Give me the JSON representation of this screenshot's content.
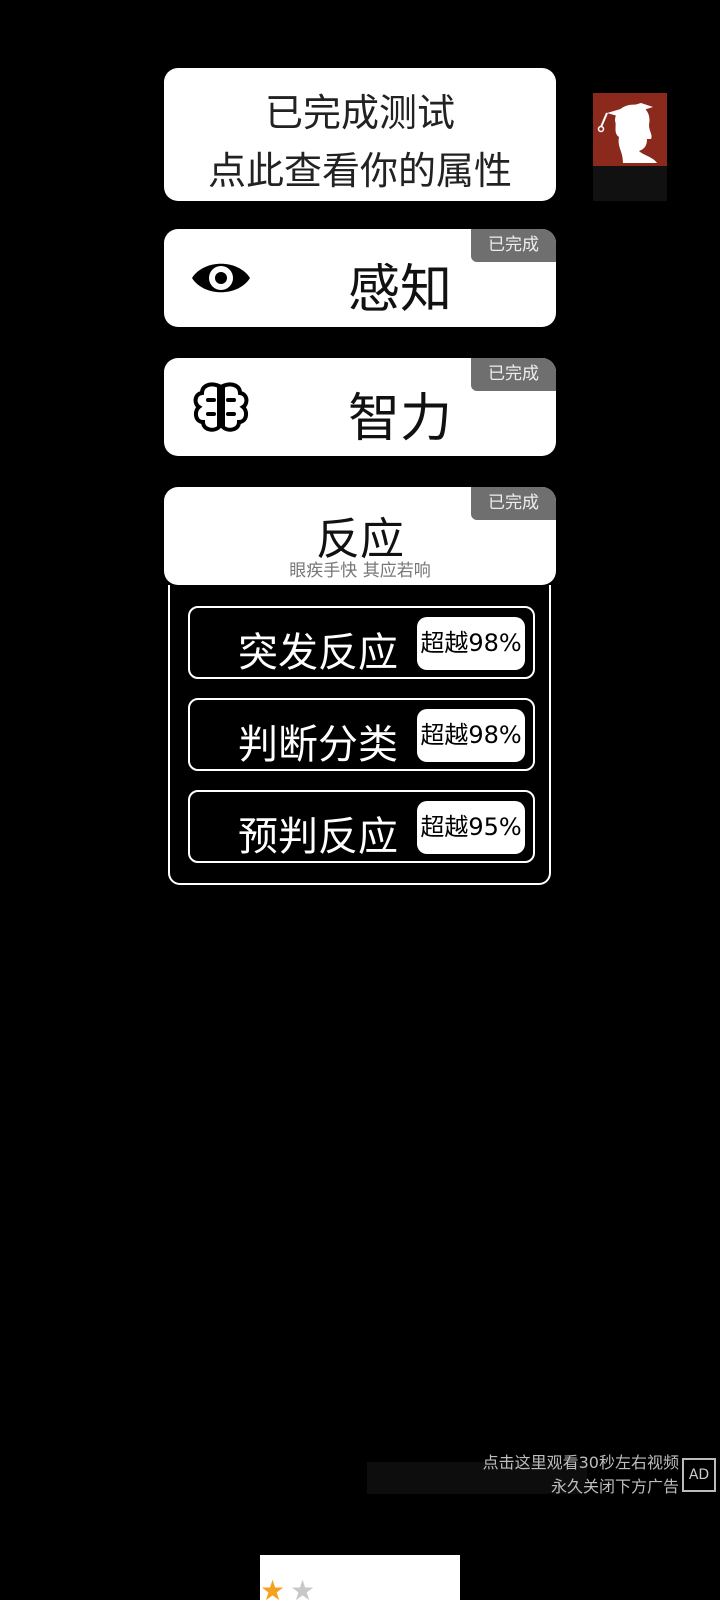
{
  "result_card": {
    "line1": "已完成测试",
    "line2": "点此查看你的属性"
  },
  "attributes": [
    {
      "title": "感知",
      "badge": "已完成",
      "icon": "eye-icon"
    },
    {
      "title": "智力",
      "badge": "已完成",
      "icon": "brain-icon"
    },
    {
      "title": "反应",
      "badge": "已完成",
      "subtitle": "眼疾手快 其应若响"
    }
  ],
  "reaction_details": [
    {
      "label": "突发反应",
      "score": "超越98%"
    },
    {
      "label": "判断分类",
      "score": "超越98%"
    },
    {
      "label": "预判反应",
      "score": "超越95%"
    }
  ],
  "ad": {
    "line1": "点击这里观看30秒左右视频",
    "line2": "永久关闭下方广告",
    "icon": "ad-off-icon",
    "icon_text": "AD"
  },
  "banner": {
    "stars_filled": 1,
    "stars_total": 2
  },
  "colors": {
    "background": "#000000",
    "badge": "#6f6f6f",
    "avatar_bg": "#8b2a1c",
    "star_active": "#f4a21e"
  }
}
